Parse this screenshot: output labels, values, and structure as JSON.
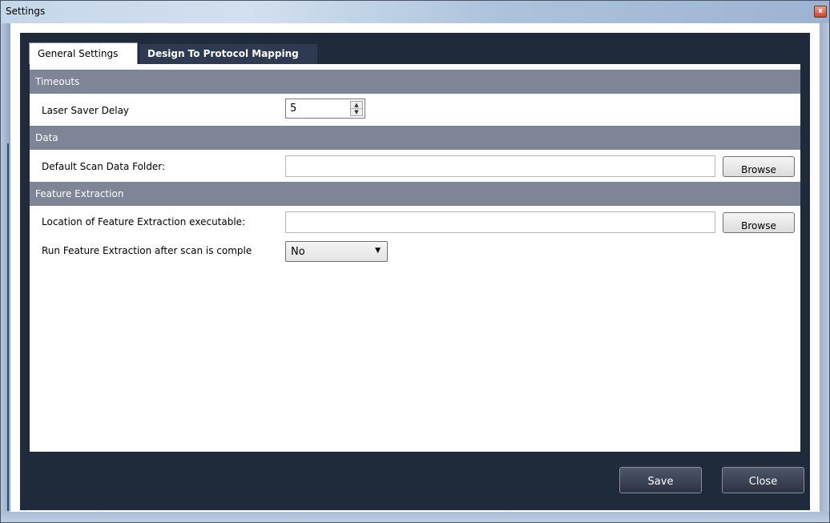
{
  "window": {
    "title": "Settings",
    "close_glyph": "x"
  },
  "tabs": [
    {
      "label": "General Settings",
      "active": true
    },
    {
      "label": "Design To Protocol Mapping",
      "active": false
    }
  ],
  "sections": {
    "timeouts": {
      "header": "Timeouts",
      "laser_saver_delay": {
        "label": "Laser Saver Delay",
        "value": "5",
        "up_glyph": "▲",
        "down_glyph": "▼"
      }
    },
    "data": {
      "header": "Data",
      "default_scan_folder": {
        "label": "Default Scan Data Folder:",
        "value": "",
        "button": "Browse"
      }
    },
    "feature_extraction": {
      "header": "Feature Extraction",
      "location": {
        "label": "Location of Feature Extraction executable:",
        "value": "",
        "button": "Browse"
      },
      "run_after_scan": {
        "label": "Run Feature Extraction after scan is comple",
        "selected": "No",
        "arrow_glyph": "▼"
      }
    }
  },
  "footer": {
    "save_label": "Save",
    "close_label": "Close"
  },
  "colors": {
    "section_header": "#7d8597",
    "dark_bg": "#1f2a3a",
    "tab_inactive": "#2d3a4f"
  },
  "icons": [
    "close-icon",
    "spin-up-icon",
    "spin-down-icon",
    "dropdown-arrow-icon"
  ]
}
